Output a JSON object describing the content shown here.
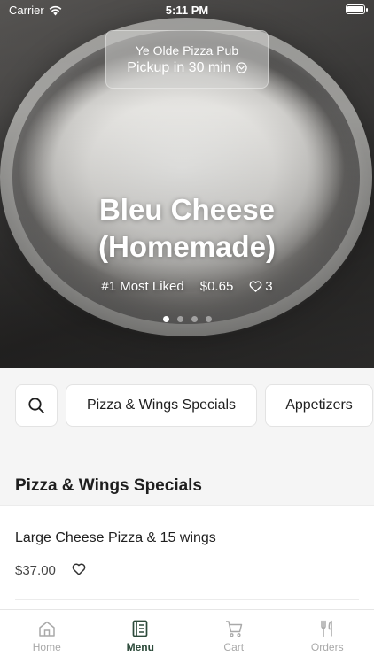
{
  "status_bar": {
    "carrier": "Carrier",
    "time": "5:11 PM"
  },
  "restaurant": {
    "name": "Ye Olde Pizza Pub",
    "pickup": "Pickup in 30 min"
  },
  "featured": {
    "title_line1": "Bleu Cheese",
    "title_line2": "(Homemade)",
    "rank": "#1 Most Liked",
    "price": "$0.65",
    "likes": "3",
    "carousel_pages": 4,
    "carousel_active": 1
  },
  "categories": {
    "items": [
      "Pizza & Wings Specials",
      "Appetizers"
    ]
  },
  "section": {
    "title": "Pizza & Wings Specials",
    "items": [
      {
        "name": "Large Cheese Pizza & 15 wings",
        "price": "$37.00"
      }
    ]
  },
  "tabs": [
    {
      "label": "Home",
      "icon": "home-icon"
    },
    {
      "label": "Menu",
      "icon": "menu-icon"
    },
    {
      "label": "Cart",
      "icon": "cart-icon"
    },
    {
      "label": "Orders",
      "icon": "utensils-icon"
    }
  ],
  "colors": {
    "accent": "#2c4a3a",
    "inactive_tab": "#a9a9a9",
    "category_background": "#f5f5f5"
  }
}
